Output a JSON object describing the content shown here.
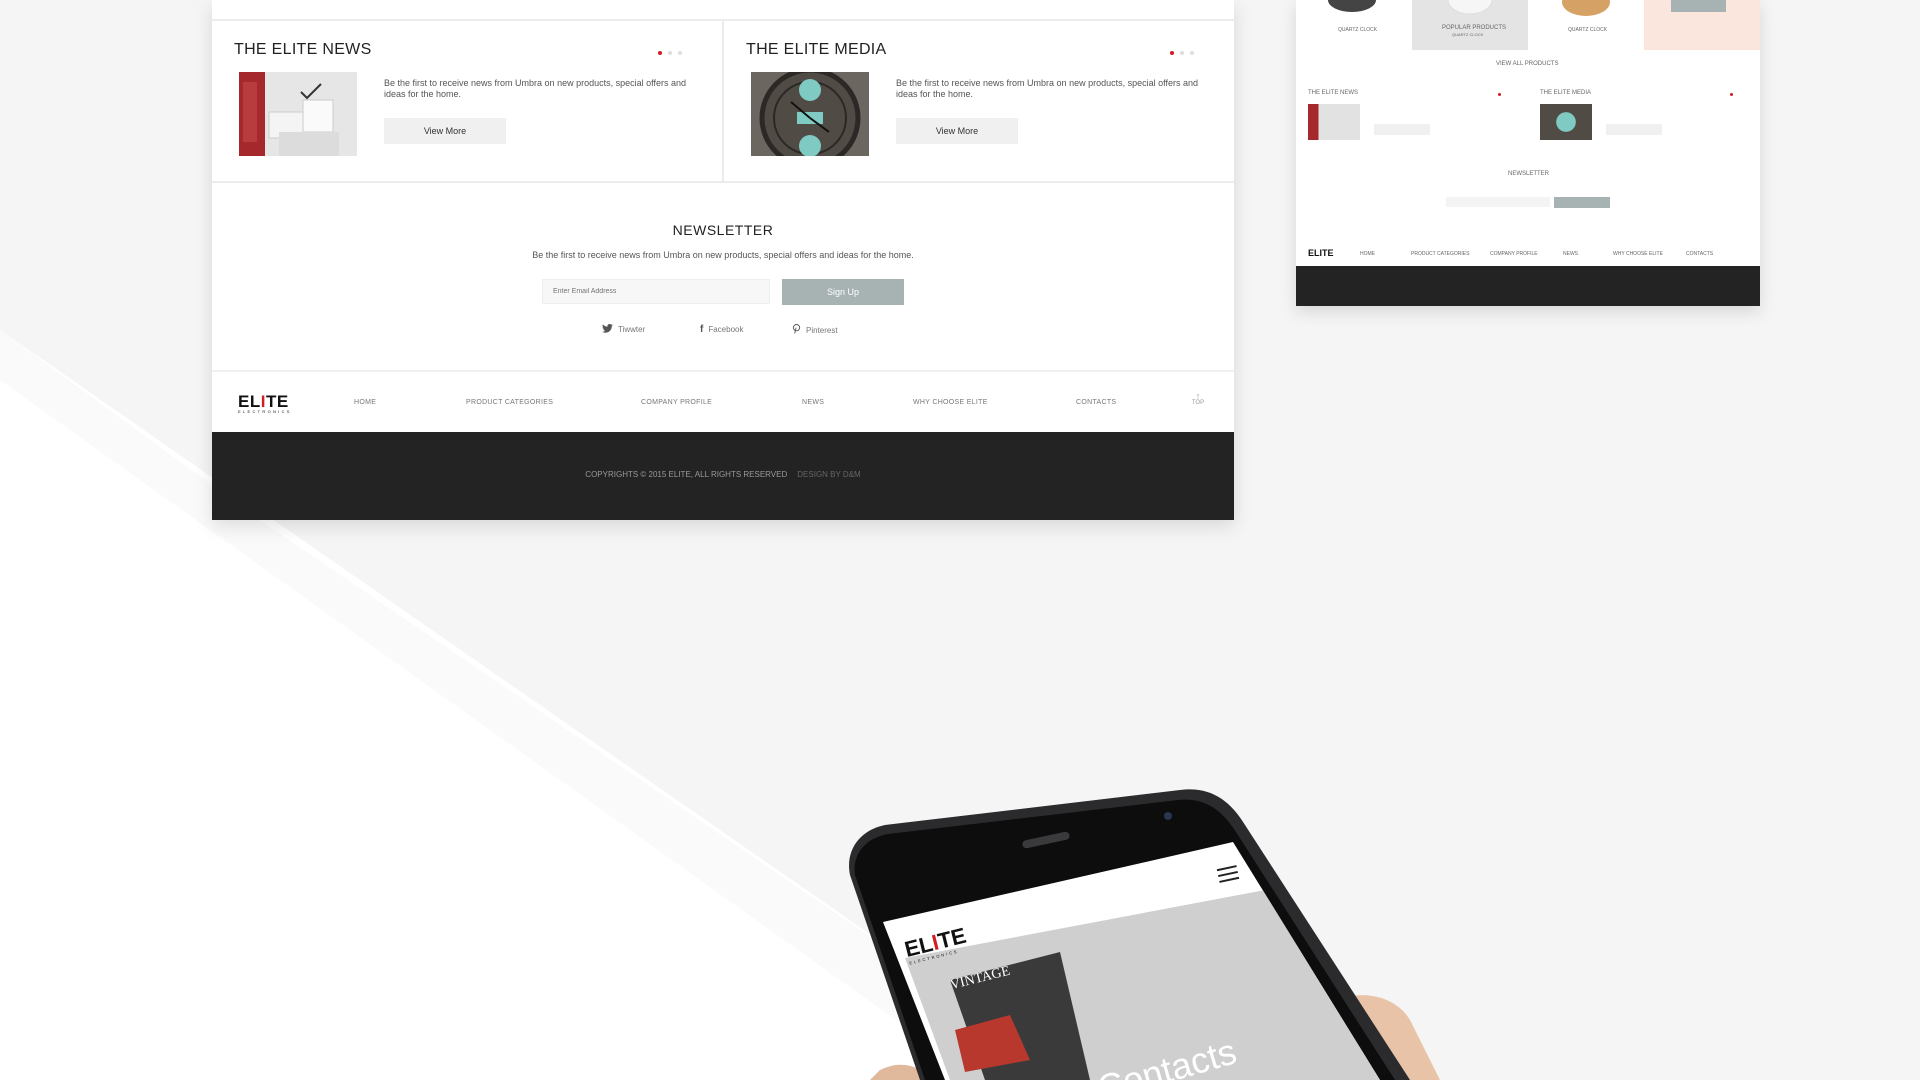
{
  "colors": {
    "accent": "#d41c24",
    "signup": "#a7b3b3",
    "footer": "#232323"
  },
  "news": {
    "title": "THE ELITE NEWS",
    "text": "Be the first to receive news from Umbra on new products, special offers and ideas for the home.",
    "button": "View More"
  },
  "media": {
    "title": "THE ELITE MEDIA",
    "text": "Be the first to receive news from Umbra on new products, special offers and ideas for the home.",
    "button": "View More"
  },
  "newsletter": {
    "title": "NEWSLETTER",
    "subtitle": "Be the first to receive news from Umbra on new products, special offers and ideas for the home.",
    "placeholder": "Enter Email Address",
    "button": "Sign Up"
  },
  "social": {
    "twitter": "Tiwwter",
    "facebook": "Facebook",
    "pinterest": "Pinterest"
  },
  "logo": {
    "name_pre": "EL",
    "name_i": "I",
    "name_post": "TE",
    "tagline": "ELECTRONICS"
  },
  "nav": [
    "HOME",
    "PRODUCT CATEGORIES",
    "COMPANY PROFILE",
    "NEWS",
    "WHY CHOOSE ELITE",
    "CONTACTS"
  ],
  "top_label": "TOP",
  "copyright": "COPYRIGHTS © 2015 ELITE, ALL RIGHTS RESERVED",
  "design_by": "DESIGN BY D&M",
  "mini": {
    "quartz_left": "QUARTZ CLOCK",
    "popular": "POPULAR PRODUCTS",
    "popular_sub": "QUARTZ CLOCK",
    "quartz_right": "QUARTZ CLOCK",
    "view_all": "VIEW ALL PRODUCTS",
    "news_title": "THE ELITE NEWS",
    "media_title": "THE ELITE MEDIA",
    "newsletter": "NEWSLETTER",
    "nav": [
      "HOME",
      "PRODUCT CATEGORIES",
      "COMPANY PROFILE",
      "NEWS",
      "WHY CHOOSE ELITE",
      "CONTACTS"
    ]
  },
  "phone": {
    "banner": "VINTAGE",
    "heading": "Contacts"
  }
}
